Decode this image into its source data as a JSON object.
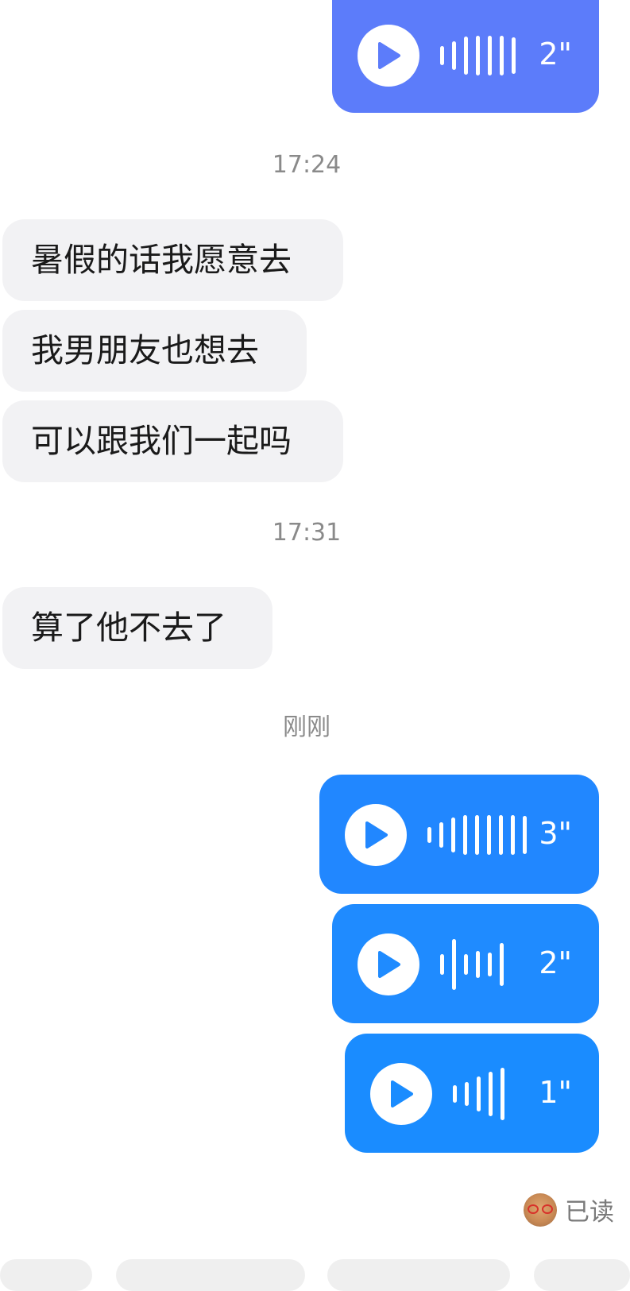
{
  "colors": {
    "voice_primary": "#5c7cfa",
    "voice_blue": "#2187ff",
    "voice_blue_light": "#1a8cff",
    "incoming_bubble": "#f2f2f4",
    "timestamp": "#8a8a8a"
  },
  "messages": {
    "voice_top": {
      "duration": "2\""
    },
    "time_1": "17:24",
    "incoming_1": "暑假的话我愿意去",
    "incoming_2": "我男朋友也想去",
    "incoming_3": "可以跟我们一起吗",
    "time_2": "17:31",
    "incoming_4": "算了他不去了",
    "time_3": "刚刚",
    "voice_1": {
      "duration": "3\""
    },
    "voice_2": {
      "duration": "2\""
    },
    "voice_3": {
      "duration": "1\""
    }
  },
  "status": {
    "read_label": "已读",
    "avatar_icon": "cat-with-red-glasses-avatar"
  }
}
